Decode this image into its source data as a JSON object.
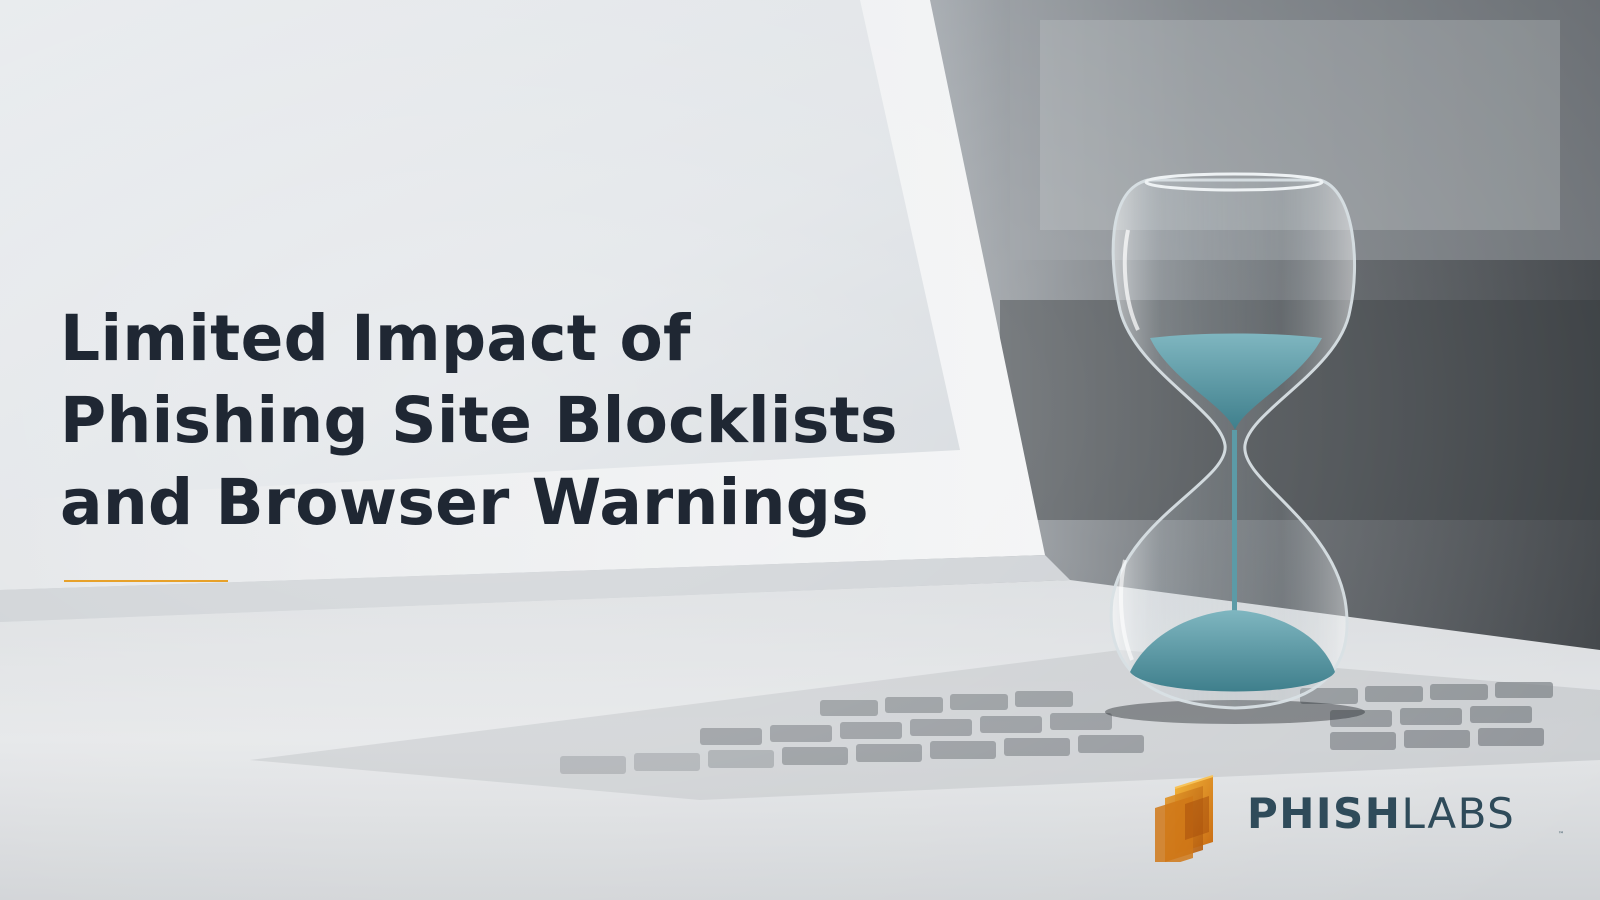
{
  "hero": {
    "title_lines": [
      "Limited Impact of",
      "Phishing Site Blocklists",
      "and Browser Warnings"
    ]
  },
  "brand": {
    "name_part_1": "PHISH",
    "name_part_2": "LABS",
    "trademark": "™",
    "mark_icon": "stacked-squares-logo-icon"
  },
  "colors": {
    "title_text": "#1f2733",
    "accent_rule": "#e7a12a",
    "brand_text": "#2f4b5a",
    "logo_orange": "#e08a1e",
    "sand_teal": "#4f96a3"
  }
}
